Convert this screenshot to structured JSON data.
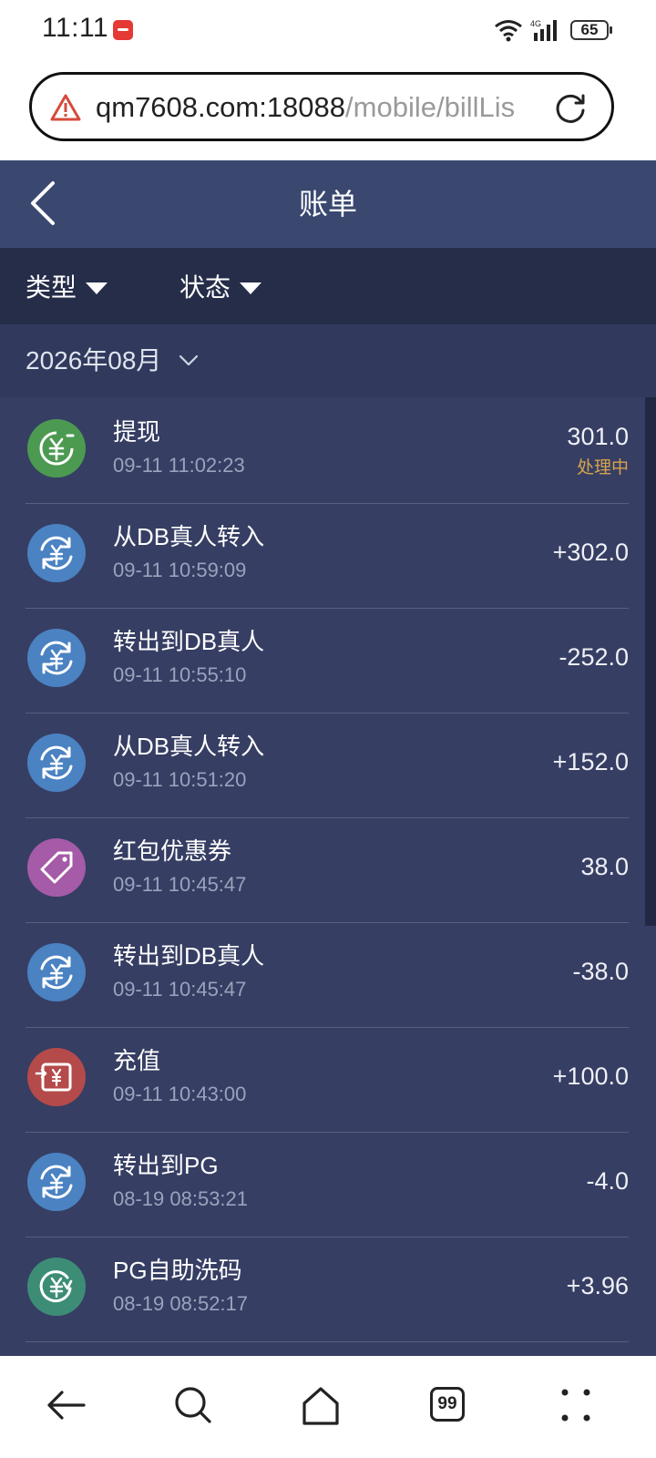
{
  "status_bar": {
    "time": "11:11",
    "network": "4G",
    "battery": "65"
  },
  "browser": {
    "url_host": "qm7608.com:18088",
    "url_path": "/mobile/billLis",
    "security_icon": "warning-triangle-icon",
    "tab_count": "99"
  },
  "header": {
    "title": "账单"
  },
  "filters": {
    "type_label": "类型",
    "status_label": "状态"
  },
  "month": {
    "label": "2026年08月"
  },
  "transactions": [
    {
      "title": "提现",
      "time": "09-11 11:02:23",
      "amount": "301.0",
      "status": "处理中",
      "icon": "withdraw-icon",
      "color": "#4c9a51"
    },
    {
      "title": "从DB真人转入",
      "time": "09-11 10:59:09",
      "amount": "+302.0",
      "status": "",
      "icon": "transfer-icon",
      "color": "#4a82c2"
    },
    {
      "title": "转出到DB真人",
      "time": "09-11 10:55:10",
      "amount": "-252.0",
      "status": "",
      "icon": "transfer-icon",
      "color": "#4a82c2"
    },
    {
      "title": "从DB真人转入",
      "time": "09-11 10:51:20",
      "amount": "+152.0",
      "status": "",
      "icon": "transfer-icon",
      "color": "#4a82c2"
    },
    {
      "title": "红包优惠券",
      "time": "09-11 10:45:47",
      "amount": "38.0",
      "status": "",
      "icon": "coupon-tag-icon",
      "color": "#a55ba7"
    },
    {
      "title": "转出到DB真人",
      "time": "09-11 10:45:47",
      "amount": "-38.0",
      "status": "",
      "icon": "transfer-icon",
      "color": "#4a82c2"
    },
    {
      "title": "充值",
      "time": "09-11 10:43:00",
      "amount": "+100.0",
      "status": "",
      "icon": "deposit-icon",
      "color": "#b54a4a"
    },
    {
      "title": "转出到PG",
      "time": "08-19 08:53:21",
      "amount": "-4.0",
      "status": "",
      "icon": "transfer-icon",
      "color": "#4a82c2"
    },
    {
      "title": "PG自助洗码",
      "time": "08-19 08:52:17",
      "amount": "+3.96",
      "status": "",
      "icon": "rebate-icon",
      "color": "#3d8d76"
    }
  ],
  "colors": {
    "header_bg": "#3a4870",
    "filter_bg": "#262d49",
    "list_bg": "#363e63",
    "status_pending": "#d6a34e"
  }
}
